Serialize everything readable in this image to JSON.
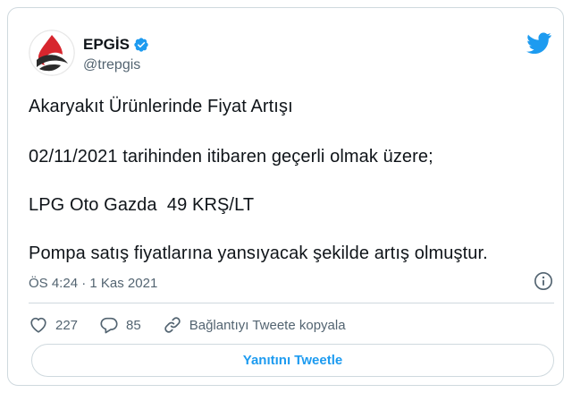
{
  "author": {
    "display_name": "EPGİS",
    "handle": "@trepgis",
    "verified": true,
    "avatar_icon": "epgis-logo-icon",
    "verified_icon": "verified-badge-icon"
  },
  "platform_icon": "twitter-bird-icon",
  "tweet": {
    "lines": [
      "Akaryakıt Ürünlerinde Fiyat Artışı",
      "02/11/2021 tarihinden itibaren geçerli olmak üzere;",
      "LPG Oto Gazda  49 KRŞ/LT",
      "Pompa satış fiyatlarına yansıyacak şekilde artış olmuştur."
    ],
    "time": "ÖS 4:24",
    "separator": " · ",
    "date": "1 Kas 2021"
  },
  "actions": {
    "like_count": "227",
    "reply_count": "85",
    "copy_link_label": "Bağlantıyı Tweete kopyala"
  },
  "reply_button_label": "Yanıtını Tweetle",
  "colors": {
    "accent": "#1d9bf0",
    "text_primary": "#0f1419",
    "text_secondary": "#536471",
    "border": "#cfd9de",
    "logo_red": "#d7262e",
    "logo_dark": "#2b2b2b"
  }
}
